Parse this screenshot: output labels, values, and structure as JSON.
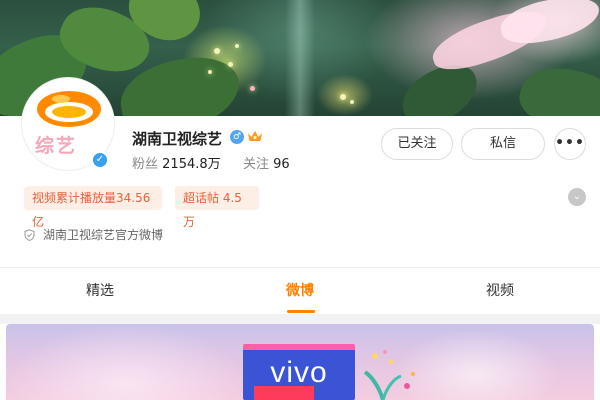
{
  "profile": {
    "name": "湖南卫视综艺",
    "avatar_text": "综艺",
    "stats": {
      "followers_label": "粉丝",
      "followers_value": "2154.8万",
      "following_label": "关注",
      "following_value": "96"
    },
    "description": "湖南卫视综艺官方微博"
  },
  "actions": {
    "follow_label": "已关注",
    "message_label": "私信",
    "more_label": "•••"
  },
  "tags": [
    {
      "text": "视频累计播放量34.56亿"
    },
    {
      "text": "超话帖 4.5万"
    }
  ],
  "tabs": [
    {
      "label": "精选",
      "active": false
    },
    {
      "label": "微博",
      "active": true
    },
    {
      "label": "视频",
      "active": false
    }
  ],
  "post": {
    "brand_text": "vivo"
  },
  "colors": {
    "accent": "#ff8200",
    "tag_bg": "#fdeee6",
    "tag_text": "#e8623a",
    "verify_blue": "#3aa0f0"
  }
}
